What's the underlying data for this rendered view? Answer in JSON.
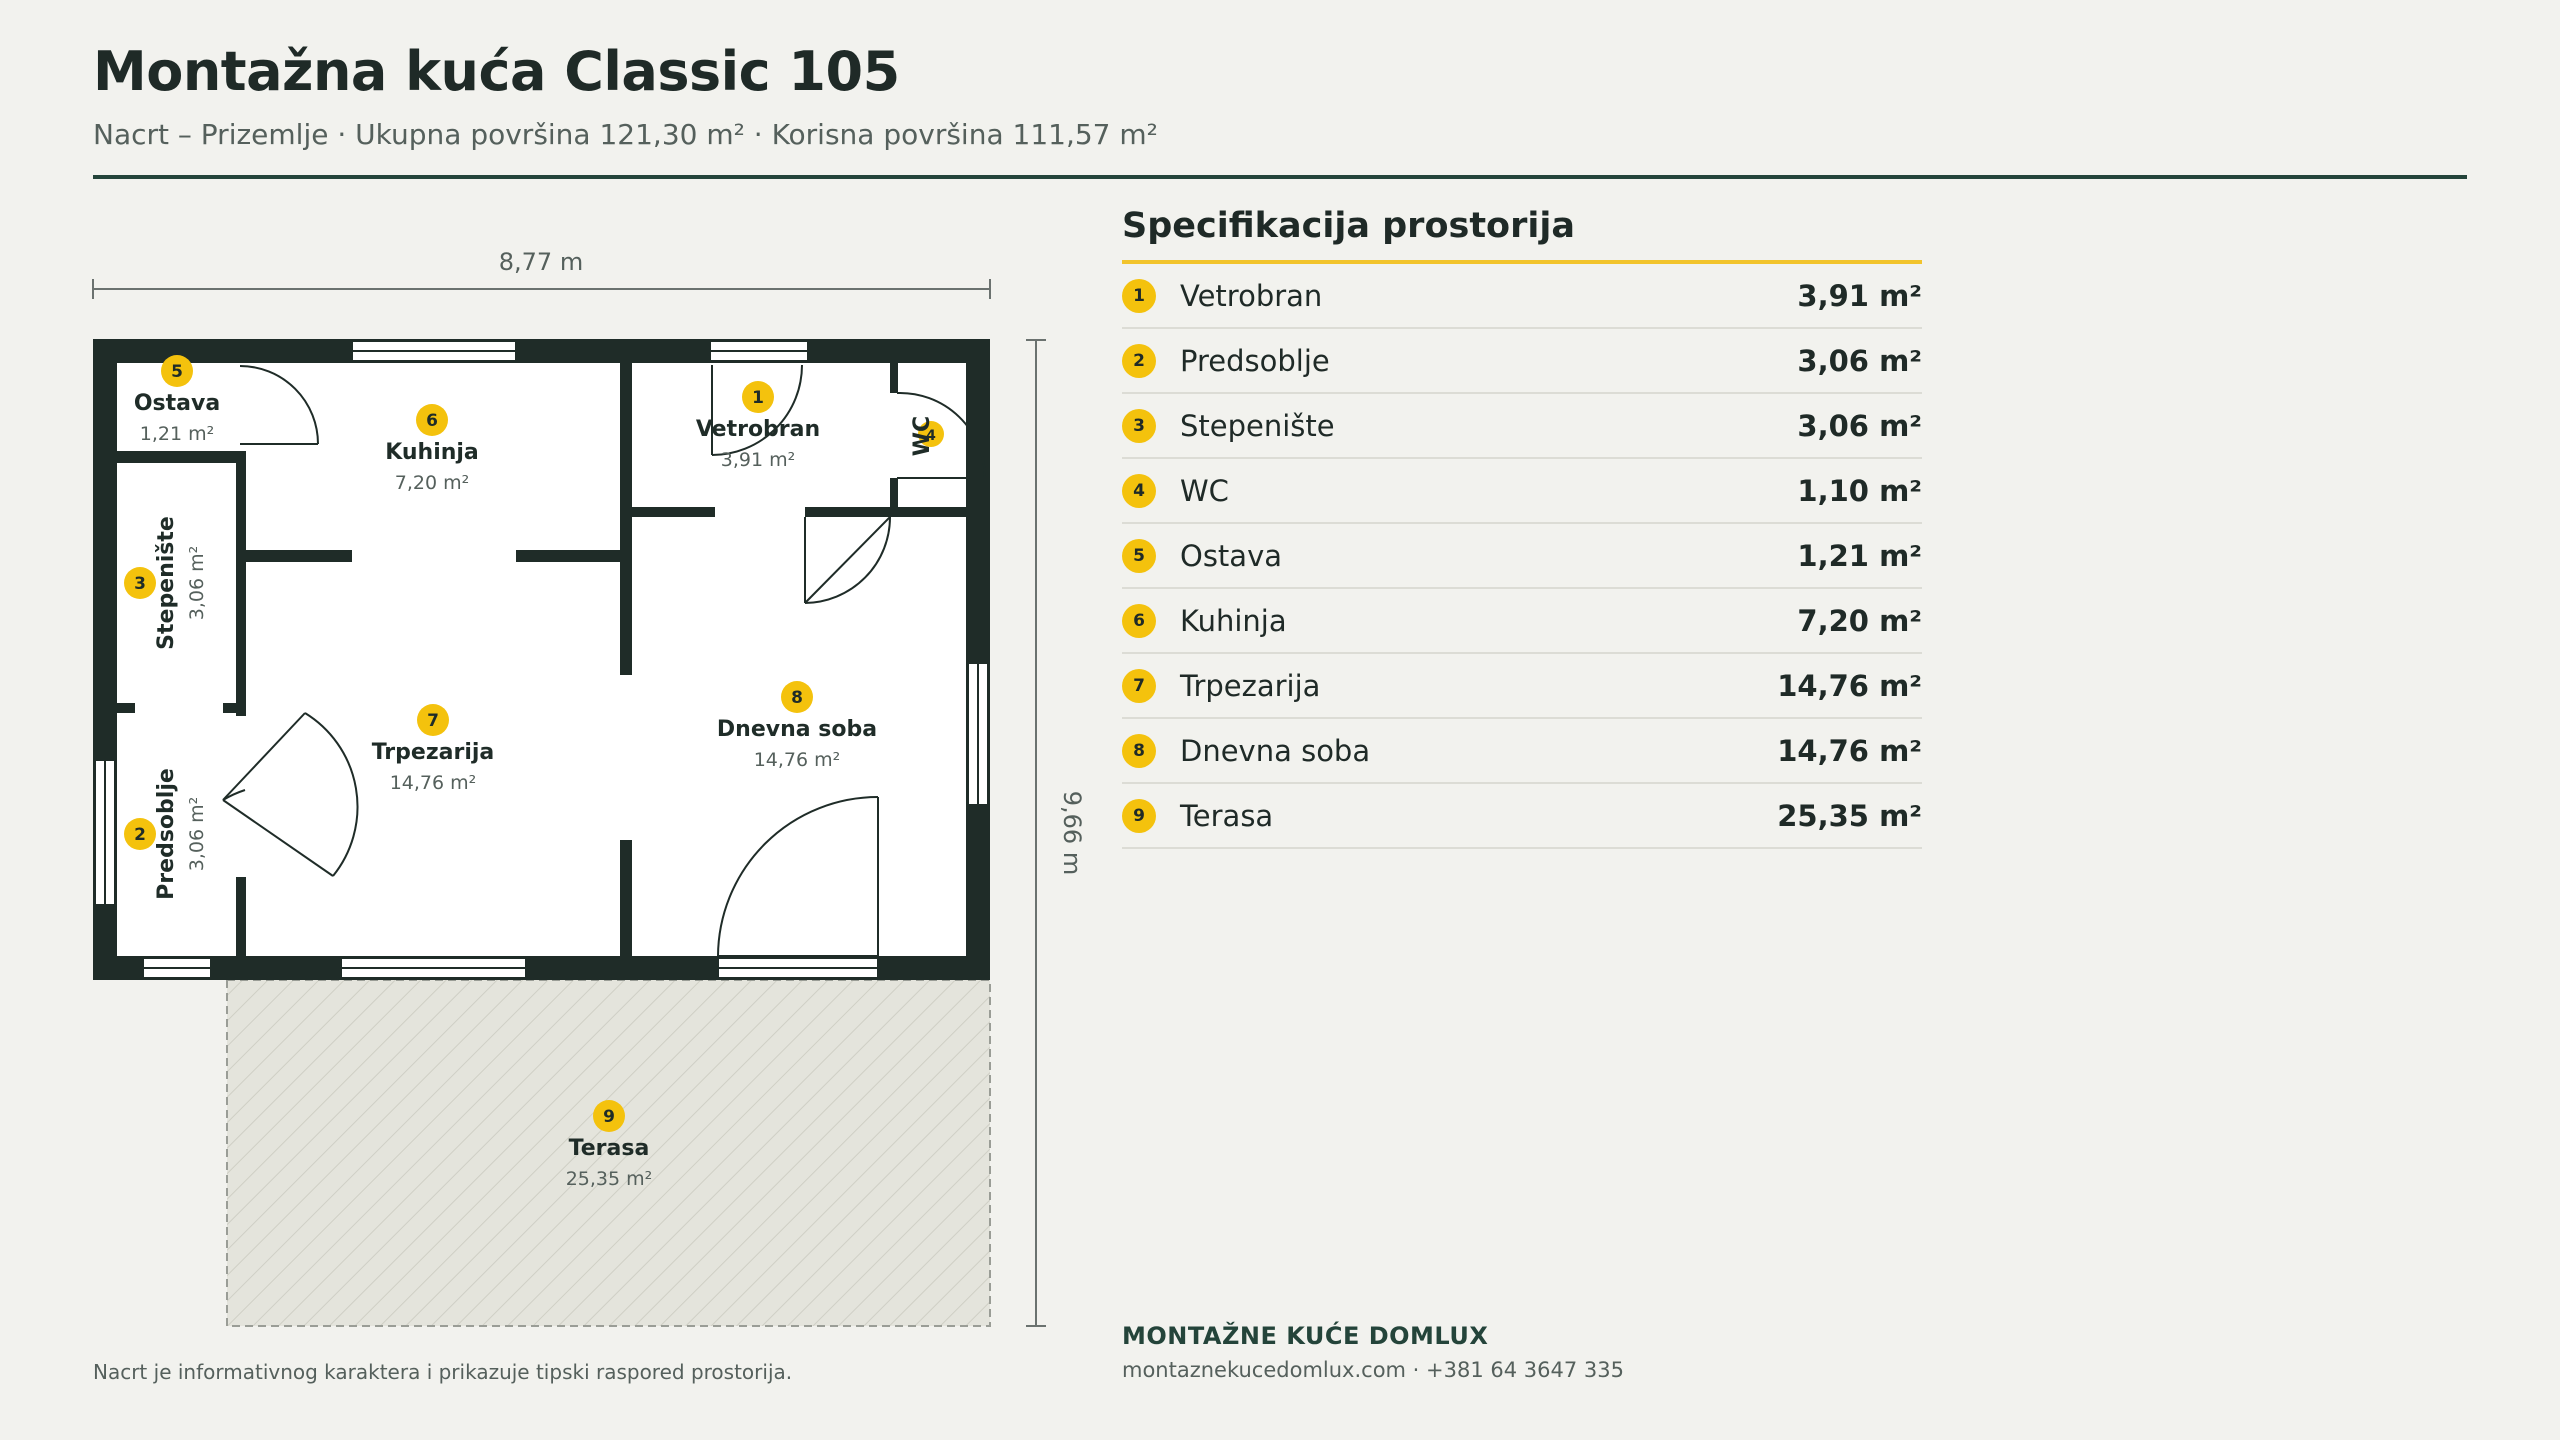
{
  "header": {
    "title": "Montažna kuća Classic 105",
    "subtitle": "Nacrt – Prizemlje · Ukupna površina 121,30 m² · Korisna površina 111,57 m²"
  },
  "plan": {
    "width_label": "8,77 m",
    "height_label": "9,66 m",
    "rooms": [
      {
        "num": "1",
        "name": "Vetrobran",
        "area": "3,91 m²"
      },
      {
        "num": "2",
        "name": "Predsoblje",
        "area": "3,06 m²"
      },
      {
        "num": "3",
        "name": "Stepenište",
        "area": "3,06 m²"
      },
      {
        "num": "4",
        "name": "WC",
        "area": ""
      },
      {
        "num": "5",
        "name": "Ostava",
        "area": "1,21 m²"
      },
      {
        "num": "6",
        "name": "Kuhinja",
        "area": "7,20 m²"
      },
      {
        "num": "7",
        "name": "Trpezarija",
        "area": "14,76 m²"
      },
      {
        "num": "8",
        "name": "Dnevna soba",
        "area": "14,76 m²"
      },
      {
        "num": "9",
        "name": "Terasa",
        "area": "25,35 m²"
      }
    ]
  },
  "spec": {
    "title": "Specifikacija prostorija",
    "rows": [
      {
        "num": "1",
        "name": "Vetrobran",
        "area": "3,91 m²"
      },
      {
        "num": "2",
        "name": "Predsoblje",
        "area": "3,06 m²"
      },
      {
        "num": "3",
        "name": "Stepenište",
        "area": "3,06 m²"
      },
      {
        "num": "4",
        "name": "WC",
        "area": "1,10 m²"
      },
      {
        "num": "5",
        "name": "Ostava",
        "area": "1,21 m²"
      },
      {
        "num": "6",
        "name": "Kuhinja",
        "area": "7,20 m²"
      },
      {
        "num": "7",
        "name": "Trpezarija",
        "area": "14,76 m²"
      },
      {
        "num": "8",
        "name": "Dnevna soba",
        "area": "14,76 m²"
      },
      {
        "num": "9",
        "name": "Terasa",
        "area": "25,35 m²"
      }
    ]
  },
  "footer": {
    "brand": "MONTAŽNE KUĆE DOMLUX",
    "contact": "montaznekucedomlux.com · +381 64 3647 335",
    "note": "Nacrt je informativnog karaktera i prikazuje tipski raspored prostorija."
  },
  "colors": {
    "wall": "#1f2c28",
    "accent": "#f4c20d",
    "rule": "#24443a",
    "terrace": "#e4e4dc"
  }
}
